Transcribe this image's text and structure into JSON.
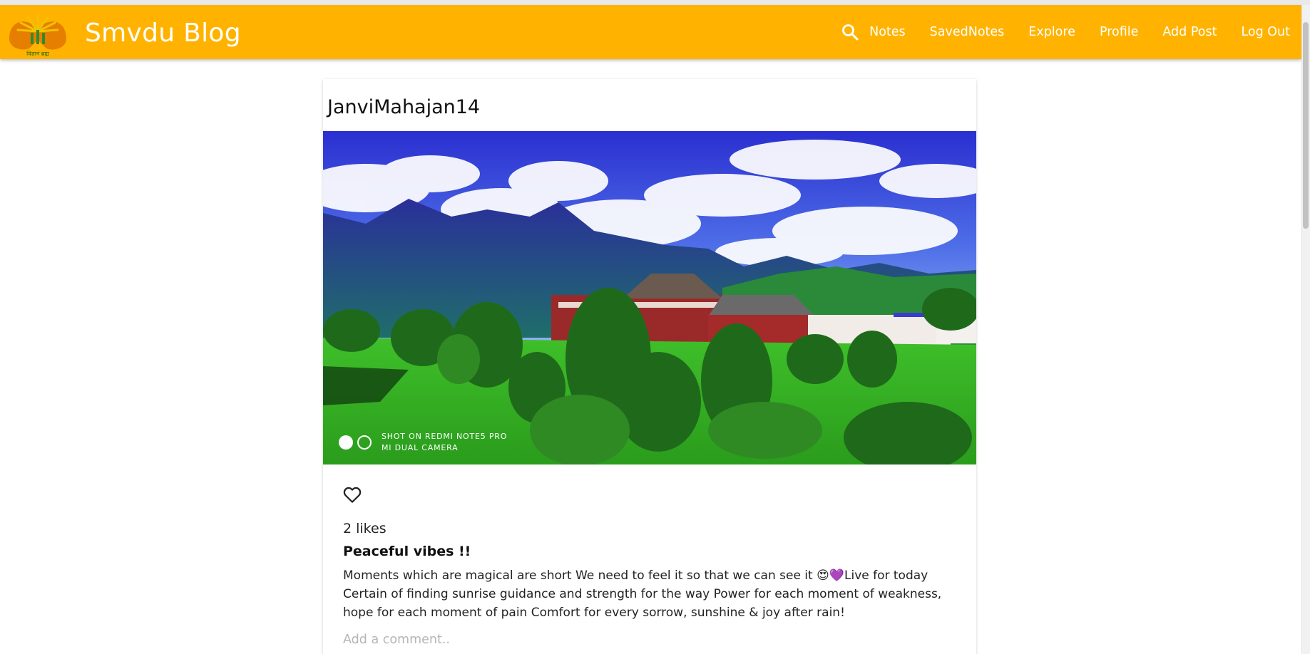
{
  "navbar": {
    "brand_title": "Smvdu Blog",
    "logo_caption": "विज्ञानं ब्रह्म",
    "links": [
      "Notes",
      "SavedNotes",
      "Explore",
      "Profile",
      "Add Post",
      "Log Out"
    ],
    "accent_color": "#ffb300",
    "search_icon": "search-icon"
  },
  "post": {
    "username": "JanviMahajan14",
    "image_watermark_line1": "SHOT ON REDMI NOTE5 PRO",
    "image_watermark_line2": "MI DUAL CAMERA",
    "like_icon": "heart-outline-icon",
    "likes_text": "2 likes",
    "title": "Peaceful vibes !!",
    "body": "Moments which are magical are short We need to feel it so that we can see it 😍💜Live for today Certain of finding sunrise guidance and strength for the way Power for each moment of weakness, hope for each moment of pain Comfort for every sorrow, sunshine & joy after rain!",
    "comment_placeholder": "Add a comment.."
  }
}
